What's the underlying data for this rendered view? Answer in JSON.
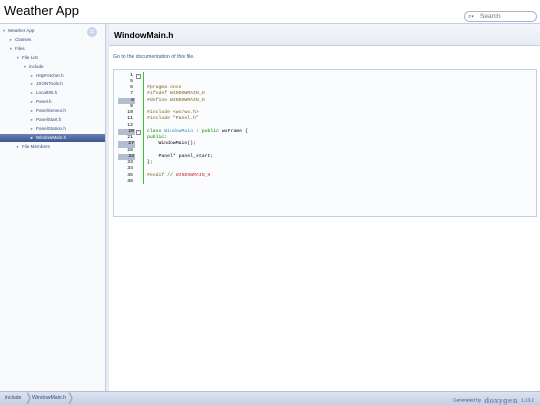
{
  "header": {
    "project_title": "Weather App",
    "search_placeholder": "Search"
  },
  "sidebar": {
    "sync_icon": "sync-icon",
    "items": [
      {
        "label": "Weather App",
        "arrow": "▼",
        "level": 0
      },
      {
        "label": "Classes",
        "arrow": "►",
        "level": 1
      },
      {
        "label": "Files",
        "arrow": "▼",
        "level": 1
      },
      {
        "label": "File List",
        "arrow": "▼",
        "level": 2
      },
      {
        "label": "include",
        "arrow": "▼",
        "level": 3
      },
      {
        "label": "HttpFetcher.h",
        "arrow": "►",
        "level": 4
      },
      {
        "label": "JSONTools.h",
        "arrow": "►",
        "level": 4
      },
      {
        "label": "LocalDB.h",
        "arrow": "►",
        "level": 4
      },
      {
        "label": "Panel.h",
        "arrow": "►",
        "level": 4
      },
      {
        "label": "PanelSensor.h",
        "arrow": "►",
        "level": 4
      },
      {
        "label": "PanelStart.h",
        "arrow": "►",
        "level": 4
      },
      {
        "label": "PanelStation.h",
        "arrow": "►",
        "level": 4
      },
      {
        "label": "WindowMain.h",
        "arrow": "►",
        "level": 4,
        "selected": true
      },
      {
        "label": "File Members",
        "arrow": "►",
        "level": 2
      }
    ]
  },
  "main": {
    "title": "WindowMain.h",
    "doc_link": "Go to the documentation of this file.",
    "code_lines": [
      {
        "n": "1",
        "shaded": false,
        "fold": "-",
        "parts": []
      },
      {
        "n": "5",
        "shaded": false,
        "parts": []
      },
      {
        "n": "6",
        "shaded": false,
        "parts": [
          {
            "c": "k-pre",
            "t": "#pragma once"
          }
        ]
      },
      {
        "n": "7",
        "shaded": false,
        "parts": [
          {
            "c": "k-pre",
            "t": "#ifndef WINDOWMAIN_H"
          }
        ]
      },
      {
        "n": "8",
        "shaded": true,
        "parts": [
          {
            "c": "k-pre",
            "t": "#define WINDOWMAIN_H"
          }
        ]
      },
      {
        "n": "9",
        "shaded": false,
        "parts": []
      },
      {
        "n": "10",
        "shaded": false,
        "parts": [
          {
            "c": "k-pre",
            "t": "#include <wx/wx.h>"
          }
        ]
      },
      {
        "n": "11",
        "shaded": false,
        "parts": [
          {
            "c": "k-pre",
            "t": "#include \"Panel.h\""
          }
        ]
      },
      {
        "n": "12",
        "shaded": false,
        "parts": []
      },
      {
        "n": "20",
        "shaded": true,
        "fold": "-",
        "parts": [
          {
            "c": "k-kw",
            "t": "class "
          },
          {
            "c": "k-type",
            "t": "WindowMain"
          },
          {
            "c": "k-plain",
            "t": " : "
          },
          {
            "c": "k-kw",
            "t": "public"
          },
          {
            "c": "k-plain",
            "t": " wxFrame {"
          }
        ]
      },
      {
        "n": "21",
        "shaded": false,
        "parts": [
          {
            "c": "k-kw",
            "t": "public"
          },
          {
            "c": "k-plain",
            "t": ":"
          }
        ]
      },
      {
        "n": "27",
        "shaded": true,
        "parts": [
          {
            "c": "k-plain",
            "t": "    WindowMain();"
          }
        ]
      },
      {
        "n": "28",
        "shaded": false,
        "parts": []
      },
      {
        "n": "33",
        "shaded": true,
        "parts": [
          {
            "c": "k-plain",
            "t": "    Panel* panel_start;"
          }
        ]
      },
      {
        "n": "33",
        "shaded": false,
        "parts": [
          {
            "c": "k-plain",
            "t": "};"
          }
        ]
      },
      {
        "n": "34",
        "shaded": false,
        "parts": []
      },
      {
        "n": "35",
        "shaded": false,
        "parts": [
          {
            "c": "k-pre",
            "t": "#endif"
          },
          {
            "c": "k-plain",
            "t": " "
          },
          {
            "c": "k-kw",
            "t": "// "
          },
          {
            "c": "k-str",
            "t": "WINDOWMAIN_H"
          }
        ]
      },
      {
        "n": "36",
        "shaded": false,
        "parts": []
      }
    ]
  },
  "footer": {
    "breadcrumbs": [
      "include",
      "WindowMain.h"
    ],
    "generated_by": "Generated by",
    "logo_text": "doxygen",
    "version": "1.13.2"
  },
  "colors": {
    "accent": "#3c5690",
    "link": "#3d578c",
    "border": "#c4cfe5"
  }
}
